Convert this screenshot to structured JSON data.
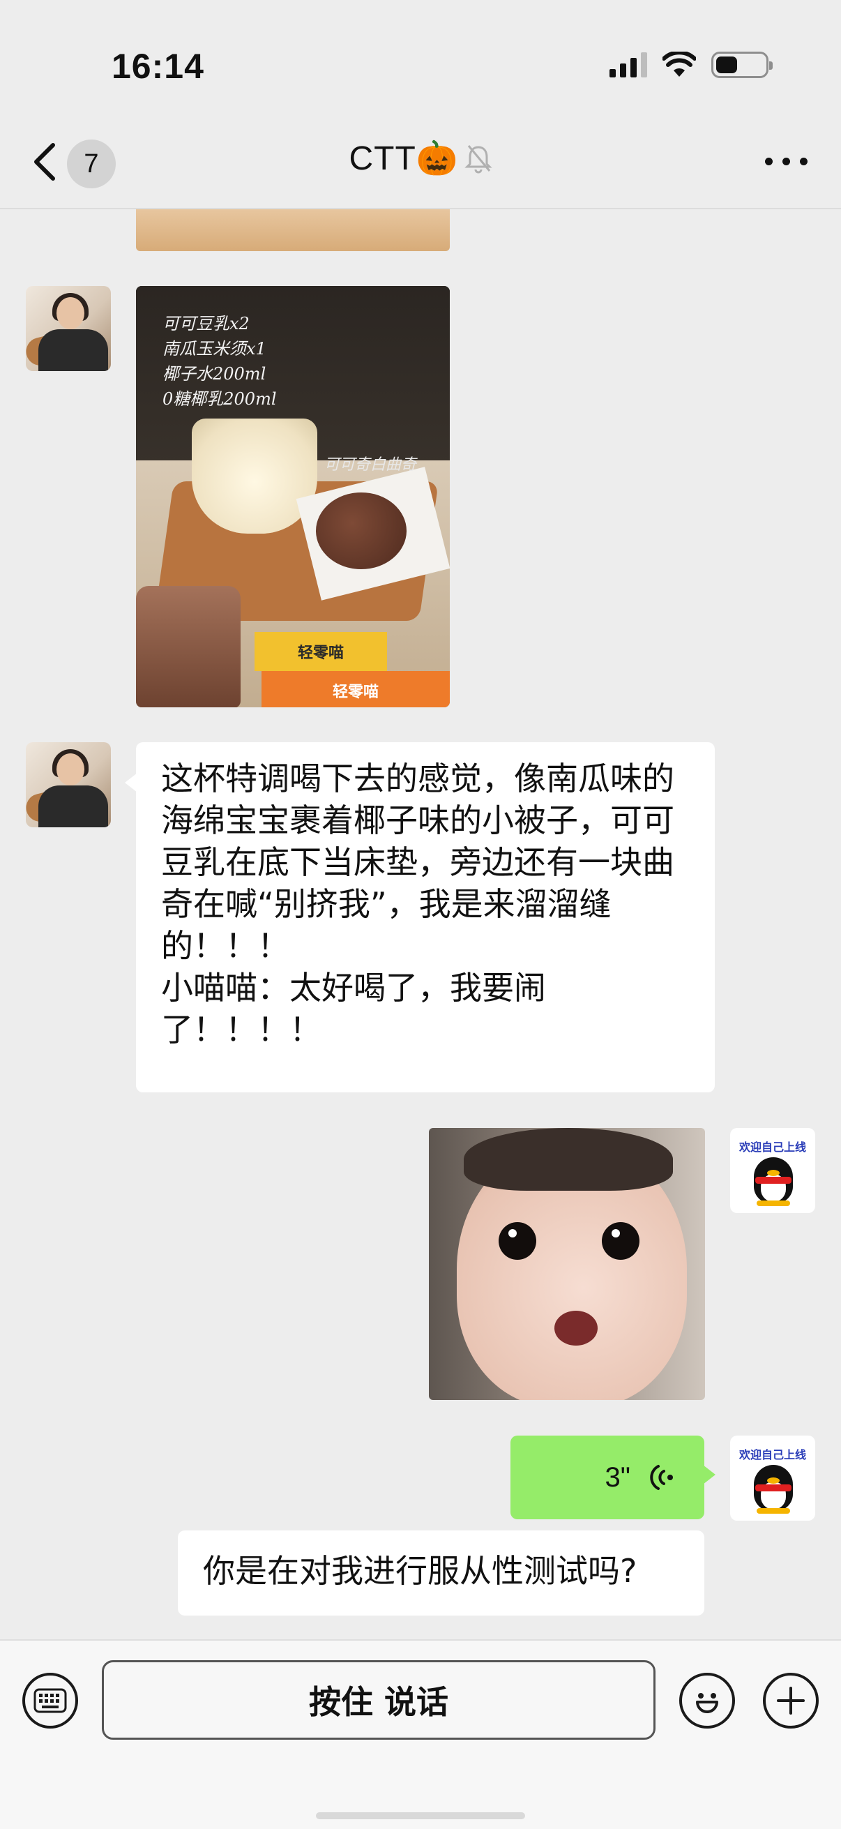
{
  "status_bar": {
    "time": "16:14"
  },
  "nav": {
    "unread_count": "7",
    "title": "CTT🎃"
  },
  "messages": {
    "photo_note": "可可豆乳x2\n南瓜玉米须x1\n椰子水200ml\n0糖椰乳200ml",
    "photo_tag": "可可奇白曲奇",
    "pack1": "轻零喵",
    "pack2": "轻零喵",
    "long_text": "这杯特调喝下去的感觉，像南瓜味的海绵宝宝裹着椰子味的小被子，可可豆乳在底下当床垫，旁边还有一块曲奇在喊“别挤我”，我是来溜溜缝的！！！\n小喵喵：太好喝了，我要闹了！！！！",
    "avatar_caption": "欢迎自己上线",
    "voice_duration": "3\"",
    "reply_text": "你是在对我进行服从性测试吗?"
  },
  "input_bar": {
    "hold_to_talk": "按住 说话"
  },
  "colors": {
    "background": "#ededed",
    "green_bubble": "#95ec69",
    "white_bubble": "#ffffff"
  }
}
